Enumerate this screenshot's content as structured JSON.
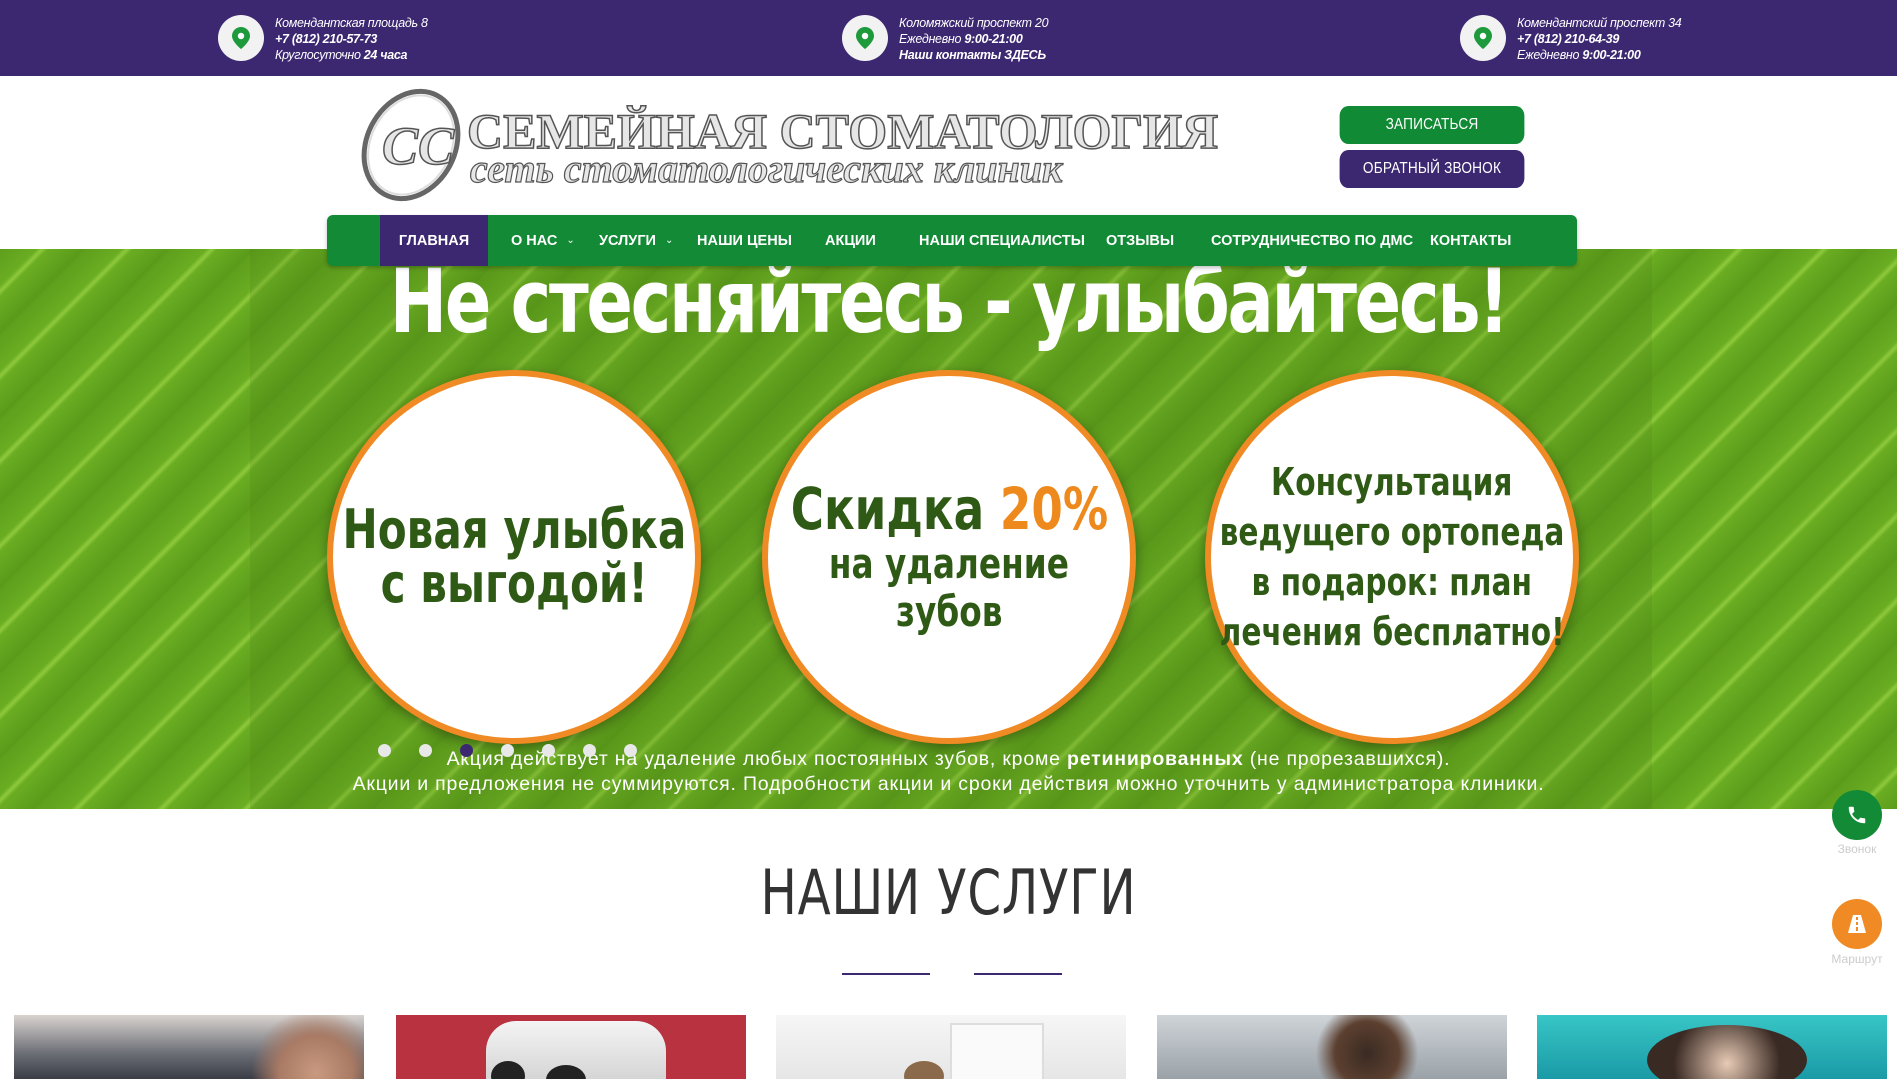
{
  "topbar": {
    "locations": [
      {
        "address": "Комендантская площадь 8",
        "phone": "+7 (812) 210-57-73",
        "hours_label": "Круглосуточно ",
        "hours_value": "24 часа"
      },
      {
        "address": "Коломяжский проспект 20",
        "hours_label": "Ежедневно ",
        "hours_value": "9:00-21:00",
        "contacts": "Наши контакты ЗДЕСЬ"
      },
      {
        "address": "Комендантский проспект 34",
        "phone": "+7 (812) 210-64-39",
        "hours_label": "Ежедневно ",
        "hours_value": "9:00-21:00"
      }
    ],
    "icon": "map-pin-icon"
  },
  "logo": {
    "mark": "СС",
    "title": "СЕМЕЙНАЯ СТОМАТОЛОГИЯ",
    "subtitle": "сеть стоматологических клиник"
  },
  "header_buttons": {
    "book": "ЗАПИСАТЬСЯ",
    "callback": "ОБРАТНЫЙ ЗВОНОК"
  },
  "nav": {
    "items": [
      {
        "label": "ГЛАВНАЯ",
        "active": true
      },
      {
        "label": "О НАС",
        "dropdown": true
      },
      {
        "label": "УСЛУГИ",
        "dropdown": true
      },
      {
        "label": "НАШИ ЦЕНЫ"
      },
      {
        "label": "АКЦИИ"
      },
      {
        "label": "НАШИ СПЕЦИАЛИСТЫ"
      },
      {
        "label": "ОТЗЫВЫ"
      },
      {
        "label": "СОТРУДНИЧЕСТВО ПО ДМС"
      },
      {
        "label": "КОНТАКТЫ"
      }
    ],
    "chevron": "⌄"
  },
  "hero": {
    "headline": "Не стесняйтесь - улыбайтесь!",
    "circle1": [
      "Новая улыбка",
      "с выгодой!"
    ],
    "circle2": {
      "line1_text": "Скидка ",
      "line1_pct": "20%",
      "line2": "на удаление",
      "line3": "зубов"
    },
    "circle3": [
      "Консультация",
      "ведущего ортопеда",
      "в подарок: план",
      "лечения бесплатно!"
    ],
    "fine1_a": "Акция действует на удаление любых постоянных зубов, кроме ",
    "fine1_b": "ретинированных",
    "fine1_c": " (не прорезавшихся).",
    "fine2": "Акции и предложения не суммируются. Подробности акции и сроки действия можно уточнить у администратора клиники.",
    "slides": {
      "count": 7,
      "active_index": 2
    }
  },
  "side_widgets": {
    "call_label": "Звонок",
    "route_label": "Маршрут"
  },
  "services": {
    "title": "НАШИ УСЛУГИ"
  },
  "colors": {
    "purple": "#3c2771",
    "green": "#138a36",
    "orange": "#f08a24"
  }
}
